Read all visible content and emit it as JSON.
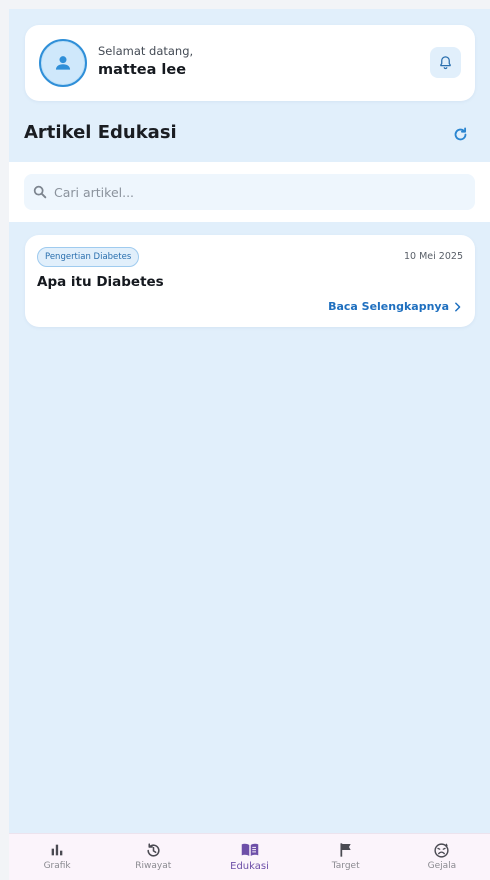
{
  "header": {
    "greeting": "Selamat datang,",
    "username": "mattea lee"
  },
  "section": {
    "title": "Artikel Edukasi"
  },
  "search": {
    "placeholder": "Cari artikel..."
  },
  "articles": [
    {
      "category": "Pengertian Diabetes",
      "date": "10 Mei 2025",
      "title": "Apa itu Diabetes",
      "read_more": "Baca Selengkapnya"
    }
  ],
  "nav": {
    "items": [
      {
        "label": "Grafik",
        "icon": "bar-chart-icon"
      },
      {
        "label": "Riwayat",
        "icon": "history-icon"
      },
      {
        "label": "Edukasi",
        "icon": "book-icon",
        "active": true
      },
      {
        "label": "Target",
        "icon": "flag-icon"
      },
      {
        "label": "Gejala",
        "icon": "sick-face-icon"
      }
    ]
  },
  "colors": {
    "background": "#e1effb",
    "accent": "#1e6fbf",
    "nav_active": "#6d4fa8"
  }
}
